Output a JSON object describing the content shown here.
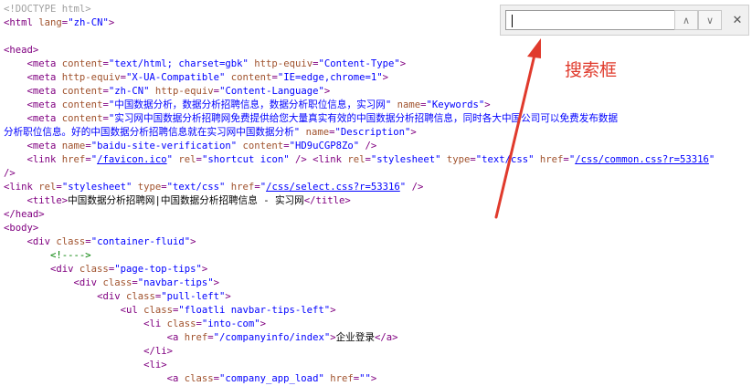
{
  "find_bar": {
    "query": "",
    "prev_icon": "chevron-up",
    "next_icon": "chevron-down",
    "close_icon": "close",
    "prev_glyph": "∧",
    "next_glyph": "∨",
    "close_glyph": "✕"
  },
  "annotation": {
    "label": "搜索框",
    "color": "#e03a2c"
  },
  "source": {
    "lines": [
      [
        {
          "c": "dim",
          "t": "<!DOCTYPE html>"
        }
      ],
      [
        {
          "c": "tag",
          "t": "<html "
        },
        {
          "c": "attr",
          "t": "lang"
        },
        {
          "c": "tag",
          "t": "="
        },
        {
          "c": "val",
          "t": "\"zh-CN\""
        },
        {
          "c": "tag",
          "t": ">"
        }
      ],
      [],
      [
        {
          "c": "tag",
          "t": "<head>"
        }
      ],
      [
        {
          "c": "txt",
          "t": "    "
        },
        {
          "c": "tag",
          "t": "<meta "
        },
        {
          "c": "attr",
          "t": "content"
        },
        {
          "c": "tag",
          "t": "="
        },
        {
          "c": "val",
          "t": "\"text/html; charset=gbk\""
        },
        {
          "c": "attr",
          "t": " http-equiv"
        },
        {
          "c": "tag",
          "t": "="
        },
        {
          "c": "val",
          "t": "\"Content-Type\""
        },
        {
          "c": "tag",
          "t": ">"
        }
      ],
      [
        {
          "c": "txt",
          "t": "    "
        },
        {
          "c": "tag",
          "t": "<meta "
        },
        {
          "c": "attr",
          "t": "http-equiv"
        },
        {
          "c": "tag",
          "t": "="
        },
        {
          "c": "val",
          "t": "\"X-UA-Compatible\""
        },
        {
          "c": "attr",
          "t": " content"
        },
        {
          "c": "tag",
          "t": "="
        },
        {
          "c": "val",
          "t": "\"IE=edge,chrome=1\""
        },
        {
          "c": "tag",
          "t": ">"
        }
      ],
      [
        {
          "c": "txt",
          "t": "    "
        },
        {
          "c": "tag",
          "t": "<meta "
        },
        {
          "c": "attr",
          "t": "content"
        },
        {
          "c": "tag",
          "t": "="
        },
        {
          "c": "val",
          "t": "\"zh-CN\""
        },
        {
          "c": "attr",
          "t": " http-equiv"
        },
        {
          "c": "tag",
          "t": "="
        },
        {
          "c": "val",
          "t": "\"Content-Language\""
        },
        {
          "c": "tag",
          "t": ">"
        }
      ],
      [
        {
          "c": "txt",
          "t": "    "
        },
        {
          "c": "tag",
          "t": "<meta "
        },
        {
          "c": "attr",
          "t": "content"
        },
        {
          "c": "tag",
          "t": "="
        },
        {
          "c": "val",
          "t": "\"中国数据分析，数据分析招聘信息，数据分析职位信息，实习网\""
        },
        {
          "c": "attr",
          "t": " name"
        },
        {
          "c": "tag",
          "t": "="
        },
        {
          "c": "val",
          "t": "\"Keywords\""
        },
        {
          "c": "tag",
          "t": ">"
        }
      ],
      [
        {
          "c": "txt",
          "t": "    "
        },
        {
          "c": "tag",
          "t": "<meta "
        },
        {
          "c": "attr",
          "t": "content"
        },
        {
          "c": "tag",
          "t": "="
        },
        {
          "c": "val",
          "t": "\"实习网中国数据分析招聘网免费提供给您大量真实有效的中国数据分析招聘信息，同时各大中国公司可以免费发布数据"
        }
      ],
      [
        {
          "c": "val",
          "t": "分析职位信息。好的中国数据分析招聘信息就在实习网中国数据分析\""
        },
        {
          "c": "attr",
          "t": " name"
        },
        {
          "c": "tag",
          "t": "="
        },
        {
          "c": "val",
          "t": "\"Description\""
        },
        {
          "c": "tag",
          "t": ">"
        }
      ],
      [
        {
          "c": "txt",
          "t": "    "
        },
        {
          "c": "tag",
          "t": "<meta "
        },
        {
          "c": "attr",
          "t": "name"
        },
        {
          "c": "tag",
          "t": "="
        },
        {
          "c": "val",
          "t": "\"baidu-site-verification\""
        },
        {
          "c": "attr",
          "t": " content"
        },
        {
          "c": "tag",
          "t": "="
        },
        {
          "c": "val",
          "t": "\"HD9uCGP8Zo\""
        },
        {
          "c": "tag",
          "t": " />"
        }
      ],
      [
        {
          "c": "txt",
          "t": "    "
        },
        {
          "c": "tag",
          "t": "<link "
        },
        {
          "c": "attr",
          "t": "href"
        },
        {
          "c": "tag",
          "t": "="
        },
        {
          "c": "val",
          "t": "\""
        },
        {
          "c": "link",
          "t": "/favicon.ico"
        },
        {
          "c": "val",
          "t": "\""
        },
        {
          "c": "attr",
          "t": " rel"
        },
        {
          "c": "tag",
          "t": "="
        },
        {
          "c": "val",
          "t": "\"shortcut icon\""
        },
        {
          "c": "tag",
          "t": " /> <link "
        },
        {
          "c": "attr",
          "t": "rel"
        },
        {
          "c": "tag",
          "t": "="
        },
        {
          "c": "val",
          "t": "\"stylesheet\""
        },
        {
          "c": "attr",
          "t": " type"
        },
        {
          "c": "tag",
          "t": "="
        },
        {
          "c": "val",
          "t": "\"text/css\""
        },
        {
          "c": "attr",
          "t": " href"
        },
        {
          "c": "tag",
          "t": "="
        },
        {
          "c": "val",
          "t": "\""
        },
        {
          "c": "link",
          "t": "/css/common.css?r=53316"
        },
        {
          "c": "val",
          "t": "\""
        }
      ],
      [
        {
          "c": "tag",
          "t": "/>"
        }
      ],
      [
        {
          "c": "tag",
          "t": "<link "
        },
        {
          "c": "attr",
          "t": "rel"
        },
        {
          "c": "tag",
          "t": "="
        },
        {
          "c": "val",
          "t": "\"stylesheet\""
        },
        {
          "c": "attr",
          "t": " type"
        },
        {
          "c": "tag",
          "t": "="
        },
        {
          "c": "val",
          "t": "\"text/css\""
        },
        {
          "c": "attr",
          "t": " href"
        },
        {
          "c": "tag",
          "t": "="
        },
        {
          "c": "val",
          "t": "\""
        },
        {
          "c": "link",
          "t": "/css/select.css?r=53316"
        },
        {
          "c": "val",
          "t": "\""
        },
        {
          "c": "tag",
          "t": " />"
        }
      ],
      [
        {
          "c": "txt",
          "t": "    "
        },
        {
          "c": "tag",
          "t": "<title>"
        },
        {
          "c": "txt",
          "t": "中国数据分析招聘网|中国数据分析招聘信息 - 实习网"
        },
        {
          "c": "tag",
          "t": "</title>"
        }
      ],
      [
        {
          "c": "tag",
          "t": "</head>"
        }
      ],
      [
        {
          "c": "tag",
          "t": "<body>"
        }
      ],
      [
        {
          "c": "txt",
          "t": "    "
        },
        {
          "c": "tag",
          "t": "<div "
        },
        {
          "c": "attr",
          "t": "class"
        },
        {
          "c": "tag",
          "t": "="
        },
        {
          "c": "val",
          "t": "\"container-fluid\""
        },
        {
          "c": "tag",
          "t": ">"
        }
      ],
      [
        {
          "c": "txt",
          "t": "        "
        },
        {
          "c": "cmt",
          "t": "<!---->"
        }
      ],
      [
        {
          "c": "txt",
          "t": "        "
        },
        {
          "c": "tag",
          "t": "<div "
        },
        {
          "c": "attr",
          "t": "class"
        },
        {
          "c": "tag",
          "t": "="
        },
        {
          "c": "val",
          "t": "\"page-top-tips\""
        },
        {
          "c": "tag",
          "t": ">"
        }
      ],
      [
        {
          "c": "txt",
          "t": "            "
        },
        {
          "c": "tag",
          "t": "<div "
        },
        {
          "c": "attr",
          "t": "class"
        },
        {
          "c": "tag",
          "t": "="
        },
        {
          "c": "val",
          "t": "\"navbar-tips\""
        },
        {
          "c": "tag",
          "t": ">"
        }
      ],
      [
        {
          "c": "txt",
          "t": "                "
        },
        {
          "c": "tag",
          "t": "<div "
        },
        {
          "c": "attr",
          "t": "class"
        },
        {
          "c": "tag",
          "t": "="
        },
        {
          "c": "val",
          "t": "\"pull-left\""
        },
        {
          "c": "tag",
          "t": ">"
        }
      ],
      [
        {
          "c": "txt",
          "t": "                    "
        },
        {
          "c": "tag",
          "t": "<ul "
        },
        {
          "c": "attr",
          "t": "class"
        },
        {
          "c": "tag",
          "t": "="
        },
        {
          "c": "val",
          "t": "\"floatli navbar-tips-left\""
        },
        {
          "c": "tag",
          "t": ">"
        }
      ],
      [
        {
          "c": "txt",
          "t": "                        "
        },
        {
          "c": "tag",
          "t": "<li "
        },
        {
          "c": "attr",
          "t": "class"
        },
        {
          "c": "tag",
          "t": "="
        },
        {
          "c": "val",
          "t": "\"into-com\""
        },
        {
          "c": "tag",
          "t": ">"
        }
      ],
      [
        {
          "c": "txt",
          "t": "                            "
        },
        {
          "c": "tag",
          "t": "<a "
        },
        {
          "c": "attr",
          "t": "href"
        },
        {
          "c": "tag",
          "t": "="
        },
        {
          "c": "val",
          "t": "\"/companyinfo/index\""
        },
        {
          "c": "tag",
          "t": ">"
        },
        {
          "c": "txt",
          "t": "企业登录"
        },
        {
          "c": "tag",
          "t": "</a>"
        }
      ],
      [
        {
          "c": "txt",
          "t": "                        "
        },
        {
          "c": "tag",
          "t": "</li>"
        }
      ],
      [
        {
          "c": "txt",
          "t": "                        "
        },
        {
          "c": "tag",
          "t": "<li>"
        }
      ],
      [
        {
          "c": "txt",
          "t": "                            "
        },
        {
          "c": "tag",
          "t": "<a "
        },
        {
          "c": "attr",
          "t": "class"
        },
        {
          "c": "tag",
          "t": "="
        },
        {
          "c": "val",
          "t": "\"company_app_load\""
        },
        {
          "c": "attr",
          "t": " href"
        },
        {
          "c": "tag",
          "t": "="
        },
        {
          "c": "val",
          "t": "\"\""
        },
        {
          "c": "tag",
          "t": ">"
        }
      ]
    ]
  }
}
